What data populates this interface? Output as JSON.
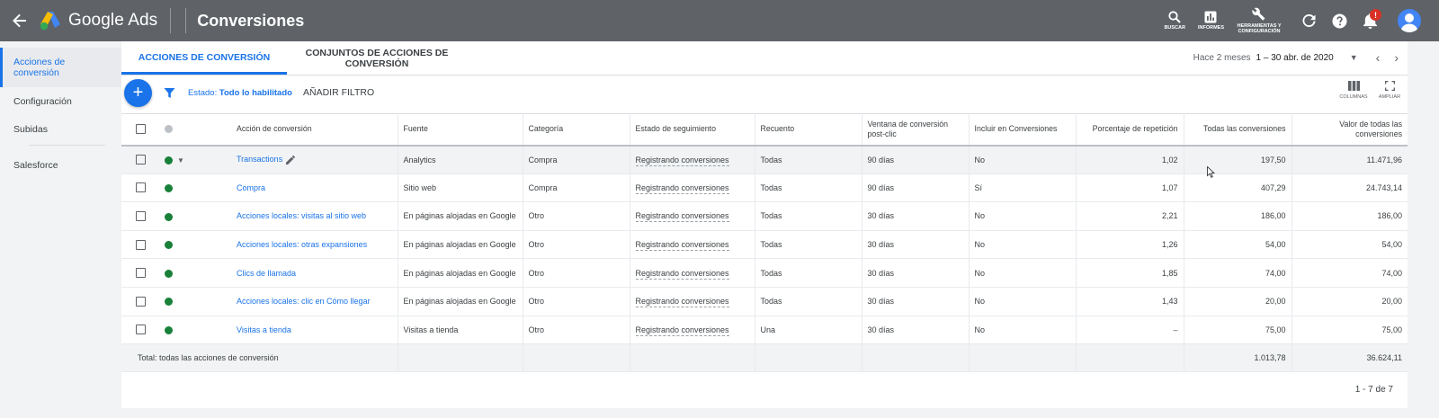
{
  "header": {
    "brand": "Google Ads",
    "page_title": "Conversiones",
    "tools": {
      "search_label": "BUSCAR",
      "reports_label": "INFORMES",
      "tools_label": "HERRAMIENTAS Y CONFIGURACIÓN"
    },
    "notification_badge": "!"
  },
  "sidebar": {
    "items": [
      {
        "label": "Acciones de conversión"
      },
      {
        "label": "Configuración"
      },
      {
        "label": "Subidas"
      },
      {
        "label": "Salesforce"
      }
    ]
  },
  "tabs": [
    {
      "label": "ACCIONES DE CONVERSIÓN"
    },
    {
      "label": "CONJUNTOS DE ACCIONES DE CONVERSIÓN"
    }
  ],
  "date": {
    "relative": "Hace 2 meses",
    "range": "1 – 30 abr. de 2020"
  },
  "filter": {
    "status_prefix": "Estado:",
    "status_value": "Todo lo habilitado",
    "add_filter": "AÑADIR FILTRO"
  },
  "view_tools": {
    "columns_label": "COLUMNAS",
    "expand_label": "AMPLIAR"
  },
  "table": {
    "headers": {
      "action": "Acción de conversión",
      "source": "Fuente",
      "category": "Categoría",
      "tracking": "Estado de seguimiento",
      "count": "Recuento",
      "window": "Ventana de conversión post-clic",
      "include": "Incluir en Conversiones",
      "repeat": "Porcentaje de repetición",
      "all_conv": "Todas las conversiones",
      "all_value": "Valor de todas las conversiones"
    },
    "rows": [
      {
        "action": "Transactions",
        "source": "Analytics",
        "category": "Compra",
        "tracking": "Registrando conversiones",
        "count": "Todas",
        "window": "90 días",
        "include": "No",
        "repeat": "1,02",
        "all_conv": "197,50",
        "all_value": "11.471,96"
      },
      {
        "action": "Compra",
        "source": "Sitio web",
        "category": "Compra",
        "tracking": "Registrando conversiones",
        "count": "Todas",
        "window": "90 días",
        "include": "Sí",
        "repeat": "1,07",
        "all_conv": "407,29",
        "all_value": "24.743,14"
      },
      {
        "action": "Acciones locales: visitas al sitio web",
        "source": "En páginas alojadas en Google",
        "category": "Otro",
        "tracking": "Registrando conversiones",
        "count": "Todas",
        "window": "30 días",
        "include": "No",
        "repeat": "2,21",
        "all_conv": "186,00",
        "all_value": "186,00"
      },
      {
        "action": "Acciones locales: otras expansiones",
        "source": "En páginas alojadas en Google",
        "category": "Otro",
        "tracking": "Registrando conversiones",
        "count": "Todas",
        "window": "30 días",
        "include": "No",
        "repeat": "1,26",
        "all_conv": "54,00",
        "all_value": "54,00"
      },
      {
        "action": "Clics de llamada",
        "source": "En páginas alojadas en Google",
        "category": "Otro",
        "tracking": "Registrando conversiones",
        "count": "Todas",
        "window": "30 días",
        "include": "No",
        "repeat": "1,85",
        "all_conv": "74,00",
        "all_value": "74,00"
      },
      {
        "action": "Acciones locales: clic en Cómo llegar",
        "source": "En páginas alojadas en Google",
        "category": "Otro",
        "tracking": "Registrando conversiones",
        "count": "Todas",
        "window": "30 días",
        "include": "No",
        "repeat": "1,43",
        "all_conv": "20,00",
        "all_value": "20,00"
      },
      {
        "action": "Visitas a tienda",
        "source": "Visitas a tienda",
        "category": "Otro",
        "tracking": "Registrando conversiones",
        "count": "Una",
        "window": "30 días",
        "include": "No",
        "repeat": "–",
        "all_conv": "75,00",
        "all_value": "75,00"
      }
    ],
    "total": {
      "label": "Total: todas las acciones de conversión",
      "all_conv": "1.013,78",
      "all_value": "36.624,11"
    }
  },
  "pagination": "1 - 7 de 7",
  "colors": {
    "header_bg": "#5f6368",
    "accent": "#1a73e8",
    "status_green": "#188038"
  }
}
